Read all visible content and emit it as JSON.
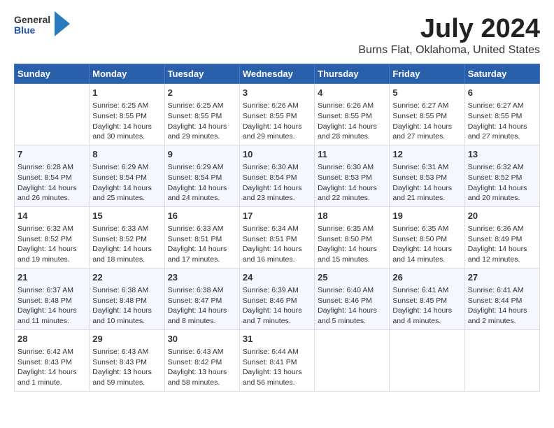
{
  "header": {
    "logo": {
      "line1": "General",
      "line2": "Blue"
    },
    "title": "July 2024",
    "subtitle": "Burns Flat, Oklahoma, United States"
  },
  "days_of_week": [
    "Sunday",
    "Monday",
    "Tuesday",
    "Wednesday",
    "Thursday",
    "Friday",
    "Saturday"
  ],
  "weeks": [
    [
      {
        "day": "",
        "sunrise": "",
        "sunset": "",
        "daylight": ""
      },
      {
        "day": "1",
        "sunrise": "Sunrise: 6:25 AM",
        "sunset": "Sunset: 8:55 PM",
        "daylight": "Daylight: 14 hours and 30 minutes."
      },
      {
        "day": "2",
        "sunrise": "Sunrise: 6:25 AM",
        "sunset": "Sunset: 8:55 PM",
        "daylight": "Daylight: 14 hours and 29 minutes."
      },
      {
        "day": "3",
        "sunrise": "Sunrise: 6:26 AM",
        "sunset": "Sunset: 8:55 PM",
        "daylight": "Daylight: 14 hours and 29 minutes."
      },
      {
        "day": "4",
        "sunrise": "Sunrise: 6:26 AM",
        "sunset": "Sunset: 8:55 PM",
        "daylight": "Daylight: 14 hours and 28 minutes."
      },
      {
        "day": "5",
        "sunrise": "Sunrise: 6:27 AM",
        "sunset": "Sunset: 8:55 PM",
        "daylight": "Daylight: 14 hours and 27 minutes."
      },
      {
        "day": "6",
        "sunrise": "Sunrise: 6:27 AM",
        "sunset": "Sunset: 8:55 PM",
        "daylight": "Daylight: 14 hours and 27 minutes."
      }
    ],
    [
      {
        "day": "7",
        "sunrise": "Sunrise: 6:28 AM",
        "sunset": "Sunset: 8:54 PM",
        "daylight": "Daylight: 14 hours and 26 minutes."
      },
      {
        "day": "8",
        "sunrise": "Sunrise: 6:29 AM",
        "sunset": "Sunset: 8:54 PM",
        "daylight": "Daylight: 14 hours and 25 minutes."
      },
      {
        "day": "9",
        "sunrise": "Sunrise: 6:29 AM",
        "sunset": "Sunset: 8:54 PM",
        "daylight": "Daylight: 14 hours and 24 minutes."
      },
      {
        "day": "10",
        "sunrise": "Sunrise: 6:30 AM",
        "sunset": "Sunset: 8:54 PM",
        "daylight": "Daylight: 14 hours and 23 minutes."
      },
      {
        "day": "11",
        "sunrise": "Sunrise: 6:30 AM",
        "sunset": "Sunset: 8:53 PM",
        "daylight": "Daylight: 14 hours and 22 minutes."
      },
      {
        "day": "12",
        "sunrise": "Sunrise: 6:31 AM",
        "sunset": "Sunset: 8:53 PM",
        "daylight": "Daylight: 14 hours and 21 minutes."
      },
      {
        "day": "13",
        "sunrise": "Sunrise: 6:32 AM",
        "sunset": "Sunset: 8:52 PM",
        "daylight": "Daylight: 14 hours and 20 minutes."
      }
    ],
    [
      {
        "day": "14",
        "sunrise": "Sunrise: 6:32 AM",
        "sunset": "Sunset: 8:52 PM",
        "daylight": "Daylight: 14 hours and 19 minutes."
      },
      {
        "day": "15",
        "sunrise": "Sunrise: 6:33 AM",
        "sunset": "Sunset: 8:52 PM",
        "daylight": "Daylight: 14 hours and 18 minutes."
      },
      {
        "day": "16",
        "sunrise": "Sunrise: 6:33 AM",
        "sunset": "Sunset: 8:51 PM",
        "daylight": "Daylight: 14 hours and 17 minutes."
      },
      {
        "day": "17",
        "sunrise": "Sunrise: 6:34 AM",
        "sunset": "Sunset: 8:51 PM",
        "daylight": "Daylight: 14 hours and 16 minutes."
      },
      {
        "day": "18",
        "sunrise": "Sunrise: 6:35 AM",
        "sunset": "Sunset: 8:50 PM",
        "daylight": "Daylight: 14 hours and 15 minutes."
      },
      {
        "day": "19",
        "sunrise": "Sunrise: 6:35 AM",
        "sunset": "Sunset: 8:50 PM",
        "daylight": "Daylight: 14 hours and 14 minutes."
      },
      {
        "day": "20",
        "sunrise": "Sunrise: 6:36 AM",
        "sunset": "Sunset: 8:49 PM",
        "daylight": "Daylight: 14 hours and 12 minutes."
      }
    ],
    [
      {
        "day": "21",
        "sunrise": "Sunrise: 6:37 AM",
        "sunset": "Sunset: 8:48 PM",
        "daylight": "Daylight: 14 hours and 11 minutes."
      },
      {
        "day": "22",
        "sunrise": "Sunrise: 6:38 AM",
        "sunset": "Sunset: 8:48 PM",
        "daylight": "Daylight: 14 hours and 10 minutes."
      },
      {
        "day": "23",
        "sunrise": "Sunrise: 6:38 AM",
        "sunset": "Sunset: 8:47 PM",
        "daylight": "Daylight: 14 hours and 8 minutes."
      },
      {
        "day": "24",
        "sunrise": "Sunrise: 6:39 AM",
        "sunset": "Sunset: 8:46 PM",
        "daylight": "Daylight: 14 hours and 7 minutes."
      },
      {
        "day": "25",
        "sunrise": "Sunrise: 6:40 AM",
        "sunset": "Sunset: 8:46 PM",
        "daylight": "Daylight: 14 hours and 5 minutes."
      },
      {
        "day": "26",
        "sunrise": "Sunrise: 6:41 AM",
        "sunset": "Sunset: 8:45 PM",
        "daylight": "Daylight: 14 hours and 4 minutes."
      },
      {
        "day": "27",
        "sunrise": "Sunrise: 6:41 AM",
        "sunset": "Sunset: 8:44 PM",
        "daylight": "Daylight: 14 hours and 2 minutes."
      }
    ],
    [
      {
        "day": "28",
        "sunrise": "Sunrise: 6:42 AM",
        "sunset": "Sunset: 8:43 PM",
        "daylight": "Daylight: 14 hours and 1 minute."
      },
      {
        "day": "29",
        "sunrise": "Sunrise: 6:43 AM",
        "sunset": "Sunset: 8:43 PM",
        "daylight": "Daylight: 13 hours and 59 minutes."
      },
      {
        "day": "30",
        "sunrise": "Sunrise: 6:43 AM",
        "sunset": "Sunset: 8:42 PM",
        "daylight": "Daylight: 13 hours and 58 minutes."
      },
      {
        "day": "31",
        "sunrise": "Sunrise: 6:44 AM",
        "sunset": "Sunset: 8:41 PM",
        "daylight": "Daylight: 13 hours and 56 minutes."
      },
      {
        "day": "",
        "sunrise": "",
        "sunset": "",
        "daylight": ""
      },
      {
        "day": "",
        "sunrise": "",
        "sunset": "",
        "daylight": ""
      },
      {
        "day": "",
        "sunrise": "",
        "sunset": "",
        "daylight": ""
      }
    ]
  ]
}
